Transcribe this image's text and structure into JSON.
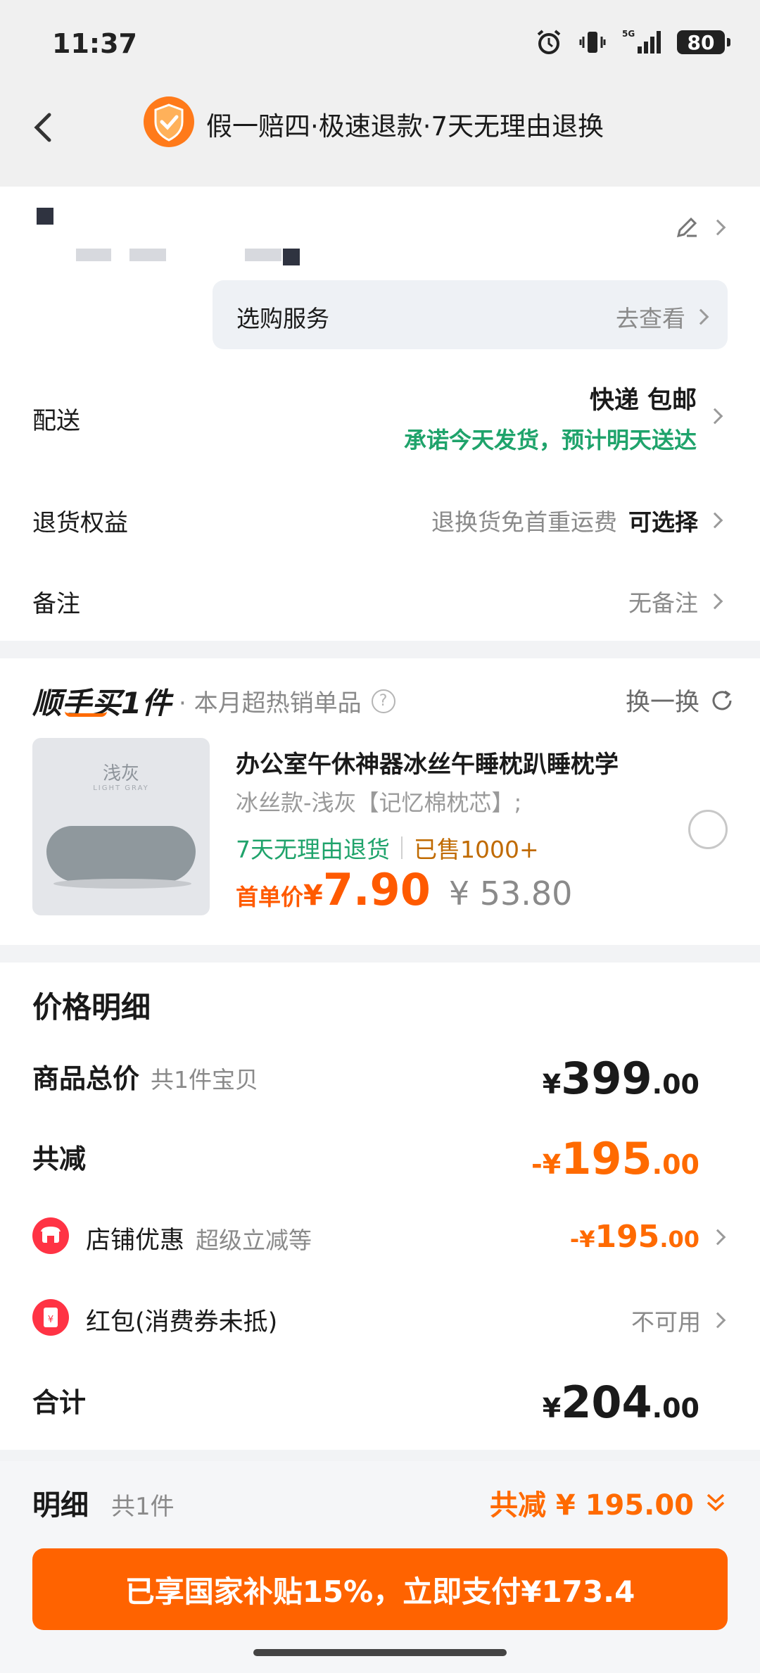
{
  "status_bar": {
    "time": "11:37",
    "network": "5G",
    "battery": "80"
  },
  "header": {
    "title": "假一赔四·极速退款·7天无理由退换"
  },
  "address": {
    "service_label": "选购服务",
    "service_link": "去查看"
  },
  "delivery": {
    "label": "配送",
    "method": "快递 包邮",
    "promise": "承诺今天发货，预计明天送达"
  },
  "returns": {
    "label": "退货权益",
    "value": "退换货免首重运费",
    "action": "可选择"
  },
  "note": {
    "label": "备注",
    "value": "无备注"
  },
  "upsell": {
    "title": "顺手买1件",
    "subtitle": "· 本月超热销单品",
    "swap": "换一换",
    "product": {
      "image_label": "浅灰",
      "image_sublabel": "LIGHT GRAY",
      "title": "办公室午休神器冰丝午睡枕趴睡枕学",
      "spec": "冰丝款-浅灰【记忆棉枕芯】;",
      "tag_return": "7天无理由退货",
      "tag_sold": "已售1000+",
      "price_label": "首单价",
      "price_currency": "¥",
      "price": "7.90",
      "original_price": "¥ 53.80"
    }
  },
  "price_detail": {
    "title": "价格明细",
    "total": {
      "label": "商品总价",
      "sub": "共1件宝贝",
      "cur": "¥",
      "int": "399",
      "dec": ".00"
    },
    "reduction": {
      "label": "共减",
      "cur": "-¥",
      "int": "195",
      "dec": ".00"
    },
    "shop_discount": {
      "label": "店铺优惠",
      "sub": "超级立减等",
      "cur": "-¥",
      "int": "195",
      "dec": ".00"
    },
    "red_packet": {
      "label": "红包(消费券未抵)",
      "value": "不可用"
    },
    "sum": {
      "label": "合计",
      "cur": "¥",
      "int": "204",
      "dec": ".00"
    }
  },
  "bottom": {
    "detail_label": "明细",
    "detail_count": "共1件",
    "reduction": "共减 ¥ 195.00",
    "pay_button": "已享国家补贴15%，立即支付¥173.4"
  },
  "colors": {
    "accent": "#ff6300",
    "green": "#1fa36b",
    "red": "#ff3344"
  }
}
